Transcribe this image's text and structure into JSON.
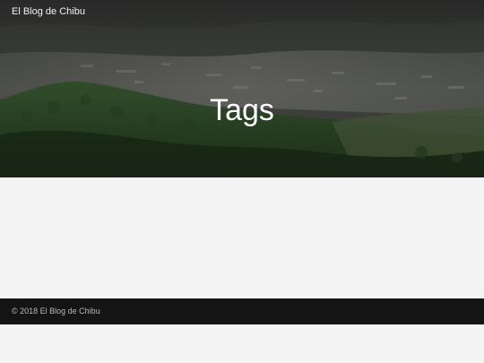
{
  "header": {
    "site_title": "El Blog de Chibu"
  },
  "hero": {
    "title": "Tags",
    "background": "mountain-city-landscape"
  },
  "footer": {
    "copyright": "© 2018 El Blog de Chibu"
  },
  "colors": {
    "page_background": "#f4f4f4",
    "footer_background": "#141414",
    "title_text": "#ffffff"
  }
}
